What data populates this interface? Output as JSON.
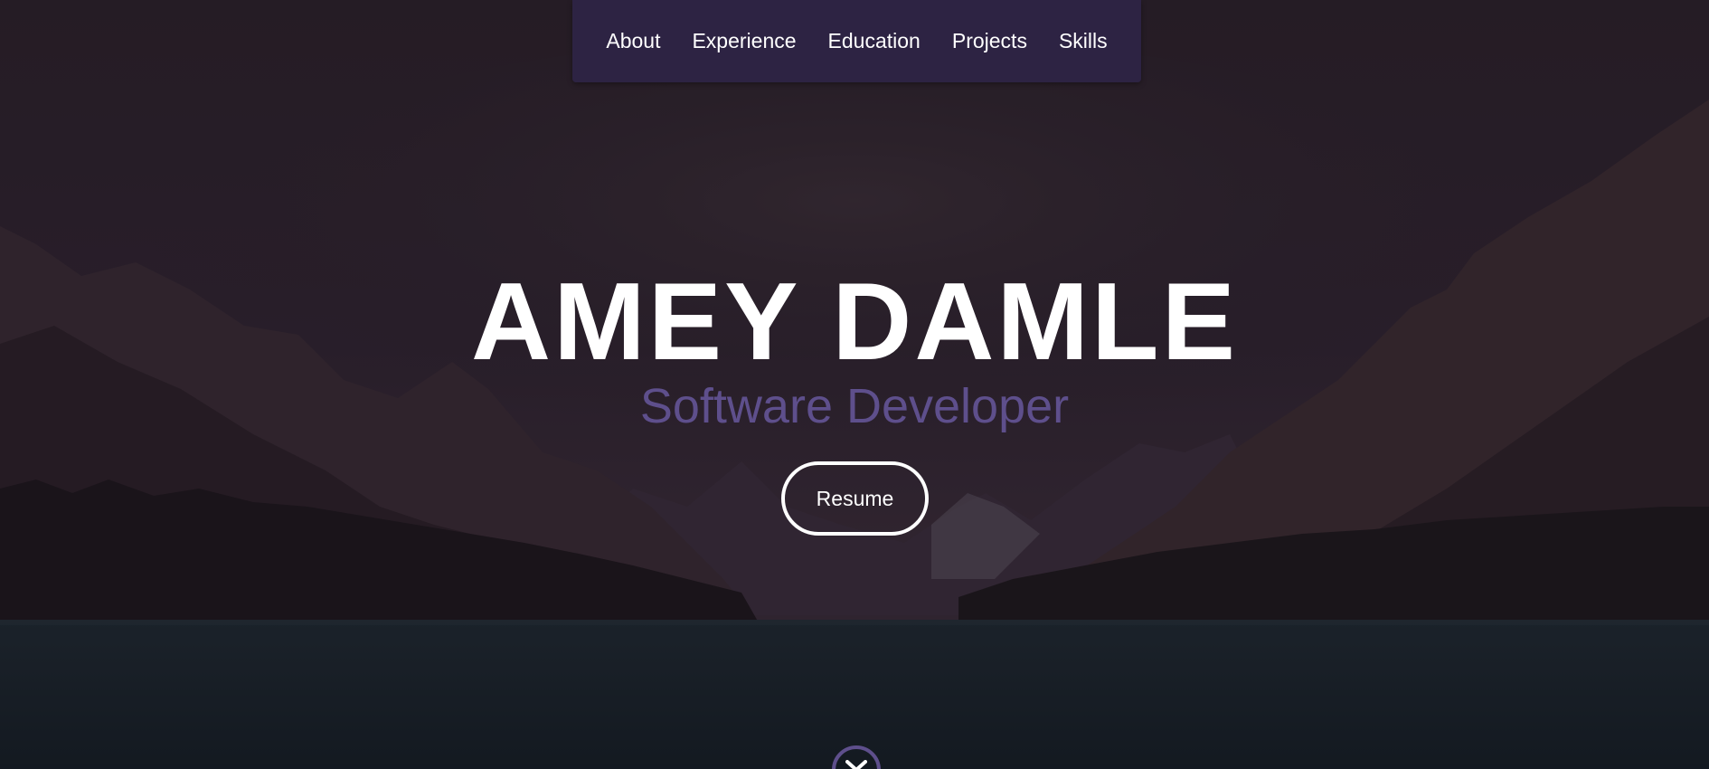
{
  "nav": {
    "items": [
      {
        "label": "About"
      },
      {
        "label": "Experience"
      },
      {
        "label": "Education"
      },
      {
        "label": "Projects"
      },
      {
        "label": "Skills"
      }
    ]
  },
  "hero": {
    "name": "AMEY DAMLE",
    "role": "Software Developer",
    "resume_label": "Resume"
  },
  "icons": {
    "scroll": "chevron-down-icon"
  },
  "colors": {
    "nav_bg": "#2d2444",
    "accent": "#5e4f8c",
    "text": "#ffffff"
  }
}
